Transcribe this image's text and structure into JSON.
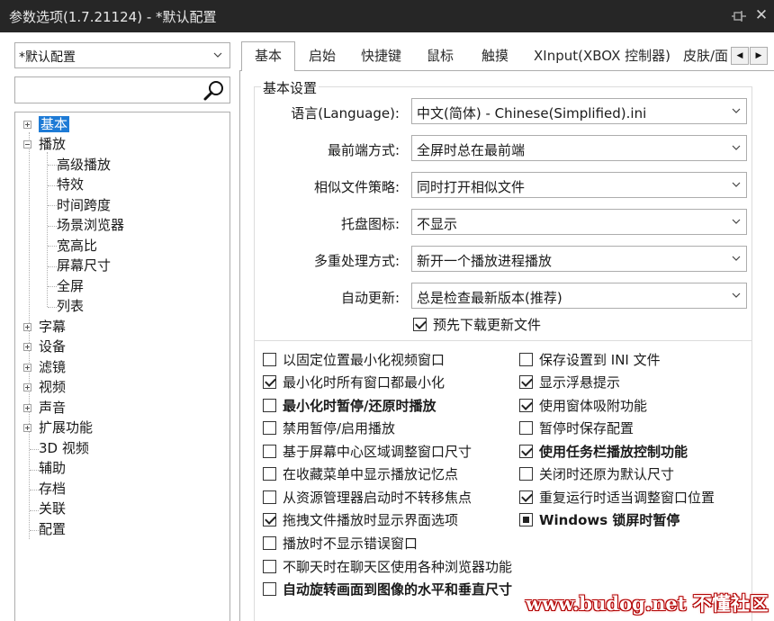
{
  "window": {
    "title": "参数选项(1.7.21124) - *默认配置"
  },
  "sidebar": {
    "preset": "*默认配置",
    "search_value": "",
    "tree": [
      {
        "label": "基本",
        "selected": true
      },
      {
        "label": "播放"
      },
      {
        "label": "高级播放"
      },
      {
        "label": "特效"
      },
      {
        "label": "时间跨度"
      },
      {
        "label": "场景浏览器"
      },
      {
        "label": "宽高比"
      },
      {
        "label": "屏幕尺寸"
      },
      {
        "label": "全屏"
      },
      {
        "label": "列表"
      },
      {
        "label": "字幕"
      },
      {
        "label": "设备"
      },
      {
        "label": "滤镜"
      },
      {
        "label": "视频"
      },
      {
        "label": "声音"
      },
      {
        "label": "扩展功能"
      },
      {
        "label": "3D 视频"
      },
      {
        "label": "辅助"
      },
      {
        "label": "存档"
      },
      {
        "label": "关联"
      },
      {
        "label": "配置"
      }
    ]
  },
  "tabs": [
    "基本",
    "启始",
    "快捷键",
    "鼠标",
    "触摸",
    "XInput(XBOX 控制器)",
    "皮肤/面"
  ],
  "basic": {
    "group_title": "基本设置",
    "rows": [
      {
        "label": "语言(Language):",
        "value": "中文(简体) - Chinese(Simplified).ini"
      },
      {
        "label": "最前端方式:",
        "value": "全屏时总在最前端"
      },
      {
        "label": "相似文件策略:",
        "value": "同时打开相似文件"
      },
      {
        "label": "托盘图标:",
        "value": "不显示"
      },
      {
        "label": "多重处理方式:",
        "value": "新开一个播放进程播放"
      },
      {
        "label": "自动更新:",
        "value": "总是检查最新版本(推荐)"
      }
    ],
    "predownload": {
      "label": "预先下载更新文件",
      "checked": true
    }
  },
  "options_left": [
    {
      "label": "以固定位置最小化视频窗口",
      "state": "unchecked",
      "bold": false
    },
    {
      "label": "最小化时所有窗口都最小化",
      "state": "checked",
      "bold": false
    },
    {
      "label": "最小化时暂停/还原时播放",
      "state": "unchecked",
      "bold": true
    },
    {
      "label": "禁用暂停/启用播放",
      "state": "unchecked",
      "bold": false
    },
    {
      "label": "基于屏幕中心区域调整窗口尺寸",
      "state": "unchecked",
      "bold": false
    },
    {
      "label": "在收藏菜单中显示播放记忆点",
      "state": "unchecked",
      "bold": false
    },
    {
      "label": "从资源管理器启动时不转移焦点",
      "state": "unchecked",
      "bold": false
    },
    {
      "label": "拖拽文件播放时显示界面选项",
      "state": "checked",
      "bold": false
    },
    {
      "label": "播放时不显示错误窗口",
      "state": "unchecked",
      "bold": false
    },
    {
      "label": "不聊天时在聊天区使用各种浏览器功能",
      "state": "unchecked",
      "bold": false
    },
    {
      "label": "自动旋转画面到图像的水平和垂直尺寸",
      "state": "unchecked",
      "bold": true
    }
  ],
  "options_right": [
    {
      "label": "保存设置到 INI 文件",
      "state": "unchecked",
      "bold": false
    },
    {
      "label": "显示浮悬提示",
      "state": "checked",
      "bold": false
    },
    {
      "label": "使用窗体吸附功能",
      "state": "checked",
      "bold": false
    },
    {
      "label": "暂停时保存配置",
      "state": "unchecked",
      "bold": false
    },
    {
      "label": "使用任务栏播放控制功能",
      "state": "checked",
      "bold": true
    },
    {
      "label": "关闭时还原为默认尺寸",
      "state": "unchecked",
      "bold": false
    },
    {
      "label": "重复运行时适当调整窗口位置",
      "state": "checked",
      "bold": false
    },
    {
      "label": "Windows 锁屏时暂停",
      "state": "partial",
      "bold": true
    }
  ],
  "watermark": "www.budog.net 不懂社区"
}
